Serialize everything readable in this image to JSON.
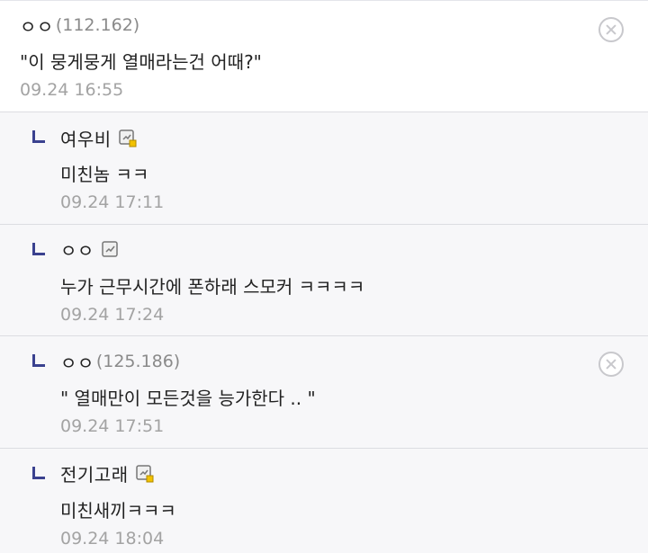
{
  "comments": [
    {
      "nick": "ㅇㅇ",
      "ip": "(112.162)",
      "text": "\"이 뭉게뭉게 열매라는건 어때?\"",
      "time": "09.24 16:55",
      "is_reply": false,
      "member_icon": null,
      "deletable": true
    },
    {
      "nick": "여우비",
      "ip": "",
      "text": "미친놈 ㅋㅋ",
      "time": "09.24 17:11",
      "is_reply": true,
      "member_icon": "semi-fixed-member-icon",
      "deletable": false
    },
    {
      "nick": "ㅇㅇ",
      "ip": "",
      "text": "누가 근무시간에 폰하래 스모커 ㅋㅋㅋㅋ",
      "time": "09.24 17:24",
      "is_reply": true,
      "member_icon": "fixed-member-icon",
      "deletable": false
    },
    {
      "nick": "ㅇㅇ",
      "ip": "(125.186)",
      "text": "\" 열매만이 모든것을 능가한다 .. \"",
      "time": "09.24 17:51",
      "is_reply": true,
      "member_icon": null,
      "deletable": true
    },
    {
      "nick": "전기고래",
      "ip": "",
      "text": "미친새끼ㅋㅋㅋ",
      "time": "09.24 18:04",
      "is_reply": true,
      "member_icon": "semi-fixed-member-icon",
      "deletable": false
    }
  ],
  "colors": {
    "reply_marker": "#3a418f",
    "reply_background": "#f7f7f9",
    "timestamp": "#a3a3a3",
    "ip": "#8a8a8a",
    "member_icon_badge": "#f2c200"
  }
}
